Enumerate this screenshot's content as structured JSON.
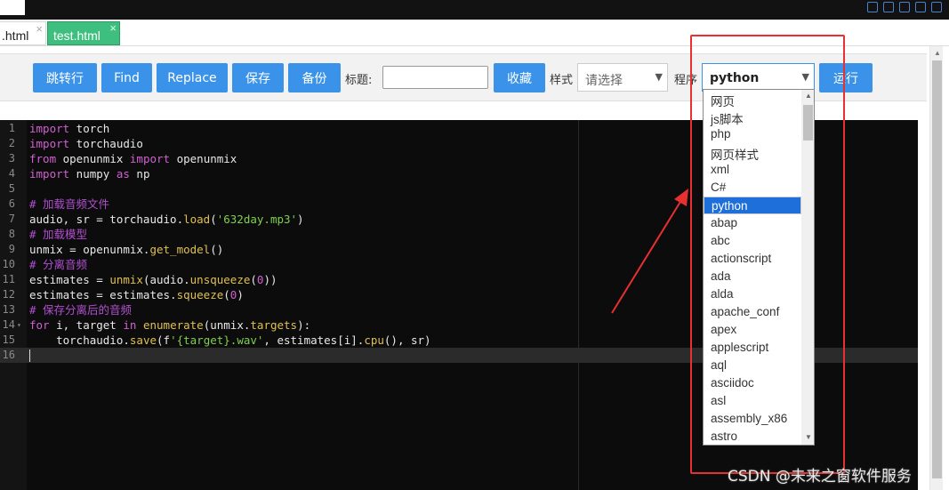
{
  "tabs": [
    {
      "label": ".html",
      "close": "×",
      "active": false
    },
    {
      "label": "test.html",
      "close": "×",
      "active": true
    }
  ],
  "toolbar": {
    "jump_label": "跳转行",
    "find_label": "Find",
    "replace_label": "Replace",
    "save_label": "保存",
    "backup_label": "备份",
    "title_label": "标题:",
    "title_value": "",
    "favorite_label": "收藏",
    "style_label": "样式",
    "style_value": "请选择",
    "program_label": "程序",
    "program_value": "python",
    "run_label": "运行"
  },
  "code_lines": [
    {
      "n": "1",
      "html": "<span class=\"kw\">import</span> torch"
    },
    {
      "n": "2",
      "html": "<span class=\"kw\">import</span> torchaudio"
    },
    {
      "n": "3",
      "html": "<span class=\"kw\">from</span> openunmix <span class=\"kw\">import</span> openunmix"
    },
    {
      "n": "4",
      "html": "<span class=\"kw\">import</span> numpy <span class=\"kw\">as</span> np"
    },
    {
      "n": "5",
      "html": ""
    },
    {
      "n": "6",
      "html": "<span class=\"cm\"># 加载音频文件</span>"
    },
    {
      "n": "7",
      "html": "audio, sr = torchaudio.<span class=\"fn\">load</span>(<span class=\"st\">'632day.mp3'</span>)"
    },
    {
      "n": "8",
      "html": "<span class=\"cm\"># 加载模型</span>"
    },
    {
      "n": "9",
      "html": "unmix = openunmix.<span class=\"fn\">get_model</span>()"
    },
    {
      "n": "10",
      "html": "<span class=\"cm\"># 分离音频</span>"
    },
    {
      "n": "11",
      "html": "estimates = <span class=\"fn\">unmix</span>(audio.<span class=\"fn\">unsqueeze</span>(<span class=\"nm\">0</span>))"
    },
    {
      "n": "12",
      "html": "estimates = estimates.<span class=\"fn\">squeeze</span>(<span class=\"nm\">0</span>)"
    },
    {
      "n": "13",
      "html": "<span class=\"cm\"># 保存分离后的音频</span>"
    },
    {
      "n": "14",
      "html": "<span class=\"kw\">for</span> i, target <span class=\"kw\">in</span> <span class=\"fn\">enumerate</span>(unmix.<span class=\"fn\">targets</span>):"
    },
    {
      "n": "15",
      "html": "    torchaudio.<span class=\"fn\">save</span>(f<span class=\"st\">'{target}.wav'</span>, estimates[i].<span class=\"fn\">cpu</span>(), sr)"
    },
    {
      "n": "16",
      "html": ""
    }
  ],
  "fold_markers": {
    "line_14": "▾"
  },
  "active_line": "16",
  "program_options": [
    "网页",
    "js脚本",
    "php",
    "网页样式",
    "xml",
    "C#",
    "python",
    "abap",
    "abc",
    "actionscript",
    "ada",
    "alda",
    "apache_conf",
    "apex",
    "applescript",
    "aql",
    "asciidoc",
    "asl",
    "assembly_x86",
    "astro"
  ],
  "selected_option": "python",
  "watermark": "CSDN @未来之窗软件服务",
  "colors": {
    "button": "#3a93e8",
    "tab_active": "#3fbf7f",
    "annotation": "#e83030",
    "selection": "#1e6fd9"
  }
}
